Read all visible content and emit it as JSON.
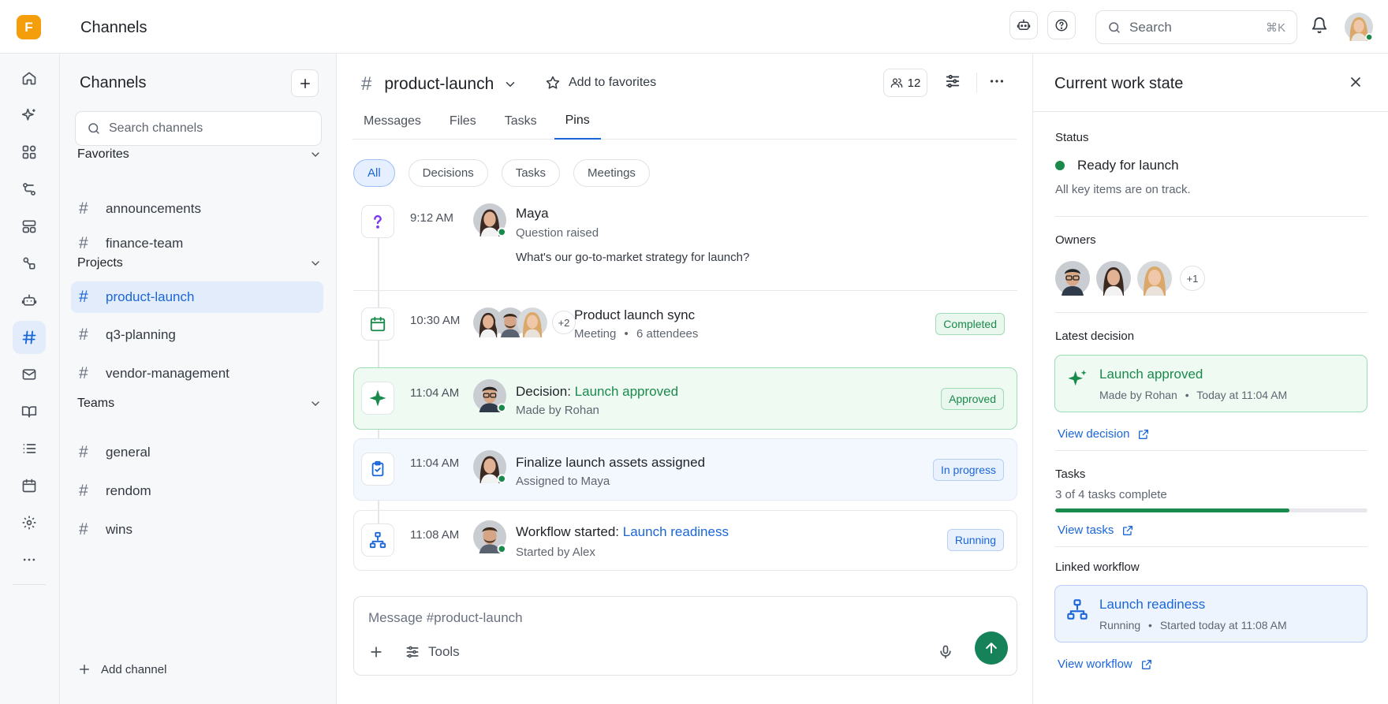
{
  "app": {
    "logo_letter": "F",
    "title": "Channels"
  },
  "topbar": {
    "search_placeholder": "Search",
    "search_shortcut": "⌘K",
    "icons": [
      "bot-icon",
      "help-icon",
      "search-icon",
      "bell-icon"
    ]
  },
  "rail": {
    "items": [
      "home",
      "sparkles",
      "apps",
      "workflows",
      "layout",
      "integrations",
      "bot",
      "channels",
      "mail",
      "book",
      "list",
      "calendar",
      "settings",
      "more"
    ],
    "active": "channels"
  },
  "sidebar": {
    "title": "Channels",
    "search_placeholder": "Search channels",
    "sections": [
      {
        "label": "Favorites",
        "items": [
          "announcements",
          "finance-team"
        ]
      },
      {
        "label": "Projects",
        "items": [
          "product-launch",
          "q3-planning",
          "vendor-management"
        ]
      },
      {
        "label": "Teams",
        "items": [
          "general",
          "rendom",
          "wins"
        ]
      }
    ],
    "active_channel": "product-launch",
    "add_channel": "Add channel"
  },
  "channel": {
    "name": "product-launch",
    "favorite_label": "Add to favorites",
    "member_count": "12",
    "tabs": [
      "Messages",
      "Files",
      "Tasks",
      "Pins"
    ],
    "active_tab": "Pins",
    "filters": [
      "All",
      "Decisions",
      "Tasks",
      "Meetings"
    ],
    "active_filter": "All"
  },
  "pins": [
    {
      "icon": "question-icon",
      "time": "9:12 AM",
      "title": "Maya",
      "subtitle": "Question raised",
      "body": "What's our go-to-market strategy for launch?"
    },
    {
      "icon": "calendar-icon",
      "time": "10:30 AM",
      "title": "Product launch sync",
      "subtitle_parts": [
        "Meeting",
        "6 attendees"
      ],
      "extra_attendees": "+2",
      "badge": "Completed"
    },
    {
      "icon": "sparkle-icon",
      "time": "11:04 AM",
      "title_prefix": "Decision:",
      "title_link": "Launch approved",
      "subtitle": "Made by Rohan",
      "badge": "Approved"
    },
    {
      "icon": "clipboard-check-icon",
      "time": "11:04 AM",
      "title": "Finalize launch assets assigned",
      "subtitle": "Assigned to Maya",
      "badge": "In progress"
    },
    {
      "icon": "workflow-icon",
      "time": "11:08 AM",
      "title_prefix": "Workflow started:",
      "title_link": "Launch readiness",
      "subtitle": "Started by Alex",
      "badge": "Running"
    }
  ],
  "composer": {
    "placeholder": "Message #product-launch",
    "tools_label": "Tools"
  },
  "panel": {
    "title": "Current work state",
    "status_label": "Status",
    "status_value": "Ready for launch",
    "status_desc": "All key items are on track.",
    "owners_label": "Owners",
    "owners_extra": "+1",
    "decision_label": "Latest decision",
    "decision_title": "Launch approved",
    "decision_sub_parts": [
      "Made by Rohan",
      "Today at 11:04 AM"
    ],
    "decision_link": "View decision",
    "tasks_label": "Tasks",
    "tasks_desc": "3 of 4 tasks complete",
    "tasks_done": 3,
    "tasks_total": 4,
    "tasks_link": "View tasks",
    "workflow_label": "Linked workflow",
    "workflow_title": "Launch readiness",
    "workflow_sub_parts": [
      "Running",
      "Started today at 11:08 AM"
    ],
    "workflow_link": "View workflow"
  },
  "colors": {
    "accent": "#1a66d9",
    "success": "#1a8a4c",
    "logo": "#f59e0b",
    "send": "#16825a"
  }
}
